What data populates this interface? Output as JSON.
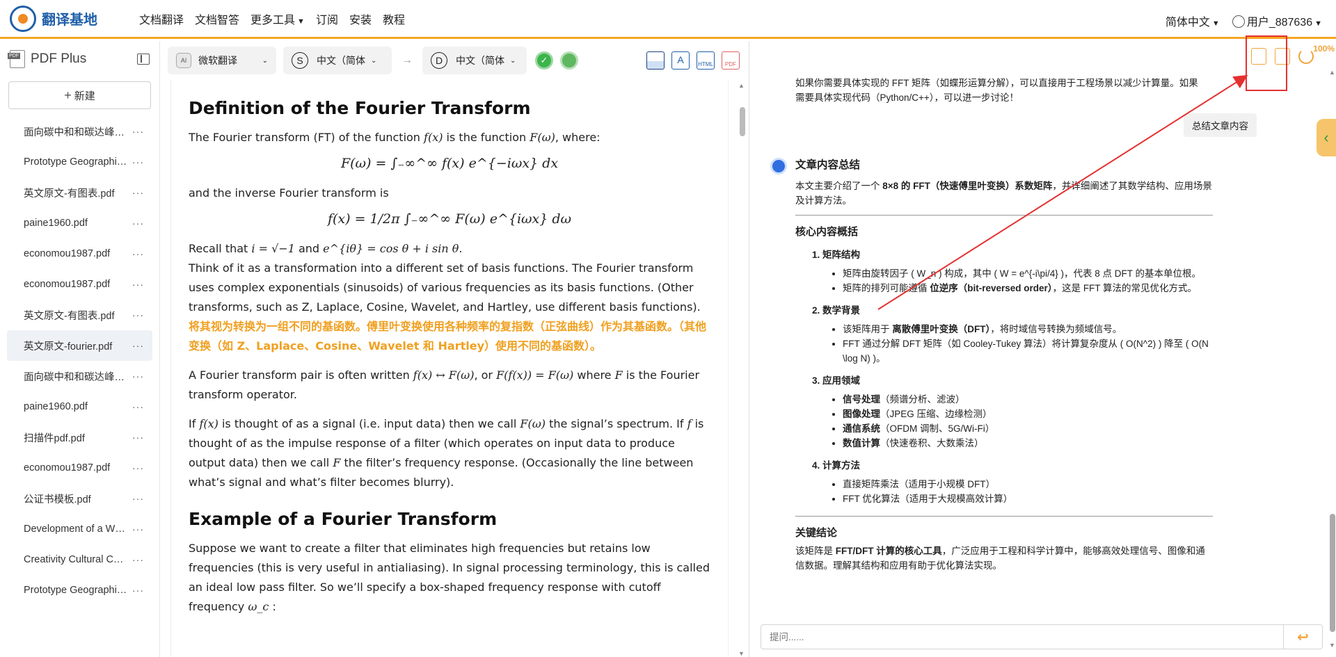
{
  "header": {
    "logo_text": "翻译基地",
    "nav": [
      "文档翻译",
      "文档智答",
      "更多工具",
      "订阅",
      "安装",
      "教程"
    ],
    "language": "简体中文",
    "user": "用户_887636"
  },
  "sidebar": {
    "title": "PDF Plus",
    "new_label": "新建",
    "files": [
      {
        "name": "面向碳中和和碳达峰…"
      },
      {
        "name": "Prototype Geographi…"
      },
      {
        "name": "英文原文-有图表.pdf"
      },
      {
        "name": "paine1960.pdf"
      },
      {
        "name": "economou1987.pdf"
      },
      {
        "name": "economou1987.pdf"
      },
      {
        "name": "英文原文-有图表.pdf"
      },
      {
        "name": "英文原文-fourier.pdf",
        "active": true
      },
      {
        "name": "面向碳中和和碳达峰…"
      },
      {
        "name": "paine1960.pdf"
      },
      {
        "name": "扫描件pdf.pdf"
      },
      {
        "name": "economou1987.pdf"
      },
      {
        "name": "公证书模板.pdf"
      },
      {
        "name": "Development of a W…"
      },
      {
        "name": "Creativity Cultural Ca…"
      },
      {
        "name": "Prototype Geographi…"
      }
    ],
    "more_label": "···"
  },
  "toolbar": {
    "engine": "微软翻译",
    "engine_icon": "AI",
    "source_letter": "S",
    "source_lang": "中文（简体",
    "target_letter": "D",
    "target_lang": "中文（简体",
    "icon_labels": {
      "html": "HTML",
      "pdf": "PDF"
    }
  },
  "document": {
    "h1": "Definition of the Fourier Transform",
    "p1_a": "The Fourier transform (FT) of the function ",
    "p1_fx": "f(x)",
    "p1_b": " is the function ",
    "p1_Fw": "F(ω)",
    "p1_c": ", where:",
    "eq1": "F(ω) = ∫₋∞^∞ f(x) e^{−iωx} dx",
    "p2": "and the inverse Fourier transform is",
    "eq2": "f(x) = 1/2π ∫₋∞^∞ F(ω) e^{iωx} dω",
    "p3_a": "Recall that ",
    "p3_m1": "i = √−1",
    "p3_b": " and ",
    "p3_m2": "e^{iθ} = cos θ + i sin θ",
    "p3_c": ".",
    "p4": "Think of it as a transformation into a different set of basis functions. The Fourier transform uses complex exponentials (sinusoids) of various frequencies as its basis functions. (Other transforms, such as Z, Laplace, Cosine, Wavelet, and Hartley, use different basis functions).",
    "p4_zh": "将其视为转换为一组不同的基函数。傅里叶变换使用各种频率的复指数（正弦曲线）作为其基函数。（其他变换（如 Z、Laplace、Cosine、Wavelet 和 Hartley）使用不同的基函数）。",
    "p5_a": "A Fourier transform pair is often written ",
    "p5_m1": "f(x) ↔ F(ω)",
    "p5_b": ", or ",
    "p5_m2": "F(f(x)) = F(ω)",
    "p5_c": " where ",
    "p5_m3": "F",
    "p5_d": " is the Fourier transform operator.",
    "p6_a": "If ",
    "p6_m1": "f(x)",
    "p6_b": " is thought of as a signal (i.e. input data) then we call ",
    "p6_m2": "F(ω)",
    "p6_c": " the signal’s spectrum. If ",
    "p6_m3": "f",
    "p6_d": " is thought of as the impulse response of a filter (which operates on input data to produce output data) then we call ",
    "p6_m4": "F",
    "p6_e": " the filter’s frequency response. (Occasionally the line between what’s signal and what’s filter becomes blurry).",
    "h2": "Example of a Fourier Transform",
    "p7_a": "Suppose we want to create a filter that eliminates high frequencies but retains low frequencies (this is very useful in antialiasing). In signal processing terminology, this is called an ideal low pass filter. So we’ll specify a box-shaped frequency response with cutoff frequency ",
    "p7_m": "ω_c",
    "p7_b": " :"
  },
  "chat": {
    "zoom": "100%",
    "top_text": "如果你需要具体实现的 FFT 矩阵（如蝶形运算分解），可以直接用于工程场景以减少计算量。如果需要具体实现代码（Python/C++），可以进一步讨论！",
    "summary_button": "总结文章内容",
    "summary_title": "文章内容总结",
    "lead_a": "本文主要介绍了一个 ",
    "lead_b": "8×8 的 FFT（快速傅里叶变换）系数矩阵",
    "lead_c": "，并详细阐述了其数学结构、应用场景及计算方法。",
    "core_title": "核心内容概括",
    "s1_title": "1. 矩阵结构",
    "s1_i1": "矩阵由旋转因子 ( W_n ) 构成，其中 ( W = e^{-i\\pi/4} )，代表 8 点 DFT 的基本单位根。",
    "s1_i2_a": "矩阵的排列可能遵循 ",
    "s1_i2_b": "位逆序（bit-reversed order）",
    "s1_i2_c": "，这是 FFT 算法的常见优化方式。",
    "s2_title": "2. 数学背景",
    "s2_i1_a": "该矩阵用于 ",
    "s2_i1_b": "离散傅里叶变换（DFT）",
    "s2_i1_c": "，将时域信号转换为频域信号。",
    "s2_i2": "FFT 通过分解 DFT 矩阵（如 Cooley-Tukey 算法）将计算复杂度从 ( O(N^2) ) 降至 ( O(N \\log N) )。",
    "s3_title": "3. 应用领域",
    "s3_items": [
      {
        "b": "信号处理",
        "t": "（频谱分析、滤波）"
      },
      {
        "b": "图像处理",
        "t": "（JPEG 压缩、边缘检测）"
      },
      {
        "b": "通信系统",
        "t": "（OFDM 调制、5G/Wi-Fi）"
      },
      {
        "b": "数值计算",
        "t": "（快速卷积、大数乘法）"
      }
    ],
    "s4_title": "4. 计算方法",
    "s4_i1": "直接矩阵乘法（适用于小规模 DFT）",
    "s4_i2": "FFT 优化算法（适用于大规模高效计算）",
    "key_title": "关键结论",
    "key_a": "该矩阵是 ",
    "key_b": "FFT/DFT 计算的核心工具",
    "key_c": "，广泛应用于工程和科学计算中，能够高效处理信号、图像和通信数据。理解其结构和应用有助于优化算法实现。",
    "ask_placeholder": "提问......"
  },
  "colors": {
    "accent": "#f2a33a",
    "highlight": "#e53030",
    "brand": "#1f5fa8"
  }
}
